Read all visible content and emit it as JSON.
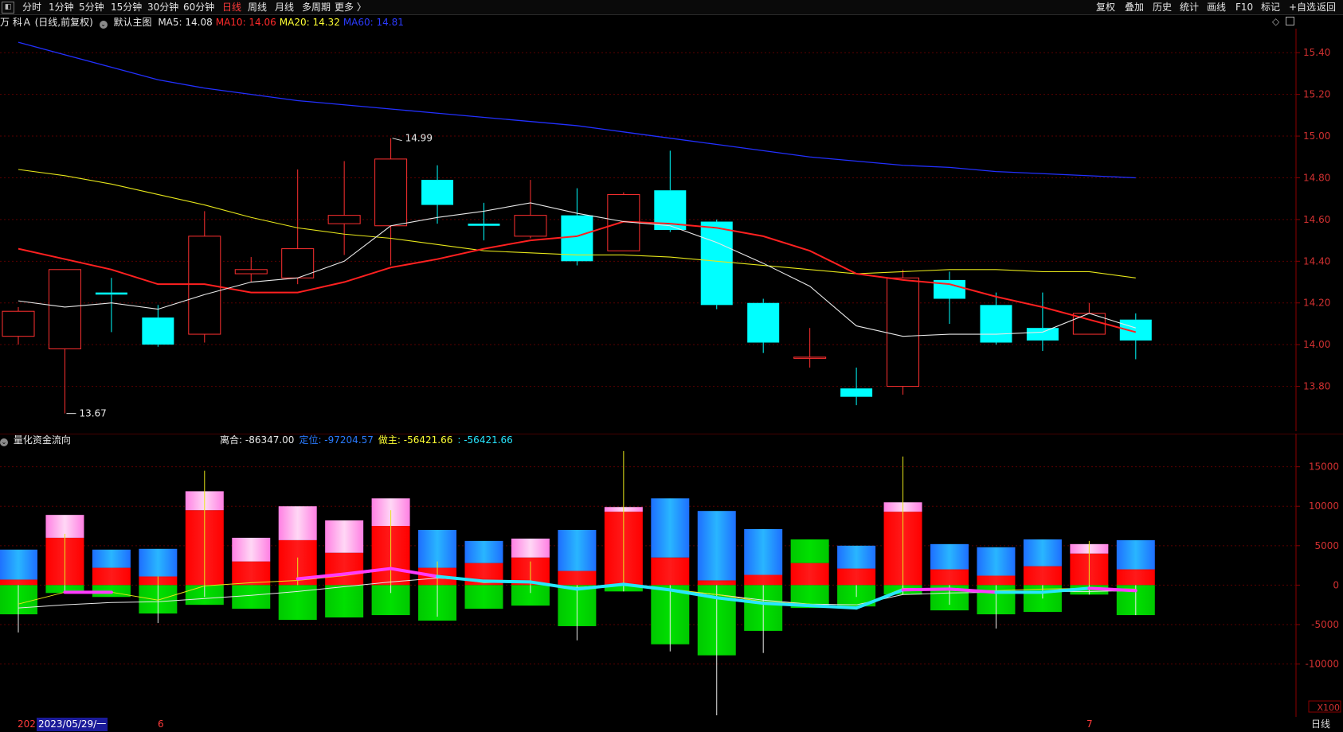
{
  "toolbar": {
    "left_items": [
      "分时",
      "1分钟",
      "5分钟",
      "15分钟",
      "30分钟",
      "60分钟",
      "日线",
      "周线",
      "月线",
      "多周期",
      "更多 〉"
    ],
    "active": "日线",
    "right_items": [
      "复权",
      "叠加",
      "历史",
      "统计",
      "画线",
      "F10",
      "标记",
      "+自选",
      "返回"
    ]
  },
  "main_chart": {
    "title": "万 科Ａ (日线,前复权)",
    "template_label": "默认主图",
    "ma": [
      {
        "label": "MA5: 14.08",
        "color": "#e8e8e8"
      },
      {
        "label": "MA10: 14.06",
        "color": "#ff2a2a"
      },
      {
        "label": "MA20: 14.32",
        "color": "#ffff33"
      },
      {
        "label": "MA60: 14.81",
        "color": "#2b3bff"
      }
    ],
    "high_label": "14.99",
    "low_label": "13.67",
    "y_ticks": [
      "15.40",
      "15.20",
      "15.00",
      "14.80",
      "14.60",
      "14.40",
      "14.20",
      "14.00",
      "13.80"
    ]
  },
  "sub_chart": {
    "title": "量化资金流向",
    "stats": [
      {
        "label": "离合: -86347.00",
        "color": "#e8e8e8"
      },
      {
        "label": "定位: -97204.57",
        "color": "#2a7bff"
      },
      {
        "label": "做主: -56421.66",
        "color": "#ffff33"
      },
      {
        "label": ": -56421.66",
        "color": "#28e6ff"
      }
    ],
    "y_ticks": [
      "15000",
      "10000",
      "5000",
      "0",
      "-5000",
      "-10000"
    ],
    "unit": "X100"
  },
  "bottom_bar": {
    "date_prefix": "202",
    "cursor_date": "2023/05/29/一",
    "month_marks": [
      "6",
      "7"
    ],
    "period_label": "日线"
  },
  "chart_data": {
    "type": "candlestick",
    "ylim": [
      13.6,
      15.5
    ],
    "candles": [
      {
        "o": 14.04,
        "h": 14.18,
        "l": 14.0,
        "c": 14.16
      },
      {
        "o": 13.98,
        "h": 14.36,
        "l": 13.67,
        "c": 14.36
      },
      {
        "o": 14.25,
        "h": 14.32,
        "l": 14.06,
        "c": 14.24
      },
      {
        "o": 14.13,
        "h": 14.19,
        "l": 13.99,
        "c": 14.0
      },
      {
        "o": 14.05,
        "h": 14.64,
        "l": 14.01,
        "c": 14.52
      },
      {
        "o": 14.34,
        "h": 14.42,
        "l": 14.3,
        "c": 14.36
      },
      {
        "o": 14.32,
        "h": 14.84,
        "l": 14.29,
        "c": 14.46
      },
      {
        "o": 14.58,
        "h": 14.88,
        "l": 14.43,
        "c": 14.62
      },
      {
        "o": 14.57,
        "h": 14.99,
        "l": 14.38,
        "c": 14.89
      },
      {
        "o": 14.79,
        "h": 14.86,
        "l": 14.58,
        "c": 14.67
      },
      {
        "o": 14.58,
        "h": 14.68,
        "l": 14.5,
        "c": 14.57
      },
      {
        "o": 14.52,
        "h": 14.79,
        "l": 14.51,
        "c": 14.62
      },
      {
        "o": 14.62,
        "h": 14.75,
        "l": 14.38,
        "c": 14.4
      },
      {
        "o": 14.45,
        "h": 14.73,
        "l": 14.45,
        "c": 14.72
      },
      {
        "o": 14.74,
        "h": 14.93,
        "l": 14.54,
        "c": 14.55
      },
      {
        "o": 14.59,
        "h": 14.6,
        "l": 14.17,
        "c": 14.19
      },
      {
        "o": 14.2,
        "h": 14.22,
        "l": 13.96,
        "c": 14.01
      },
      {
        "o": 13.94,
        "h": 14.08,
        "l": 13.89,
        "c": 13.94
      },
      {
        "o": 13.79,
        "h": 13.89,
        "l": 13.71,
        "c": 13.75
      },
      {
        "o": 13.8,
        "h": 14.36,
        "l": 13.76,
        "c": 14.32
      },
      {
        "o": 14.31,
        "h": 14.35,
        "l": 14.1,
        "c": 14.22
      },
      {
        "o": 14.19,
        "h": 14.25,
        "l": 14.0,
        "c": 14.01
      },
      {
        "o": 14.08,
        "h": 14.25,
        "l": 13.97,
        "c": 14.02
      },
      {
        "o": 14.05,
        "h": 14.2,
        "l": 14.05,
        "c": 14.15
      },
      {
        "o": 14.12,
        "h": 14.15,
        "l": 13.93,
        "c": 14.02
      }
    ],
    "ma5": [
      14.21,
      14.18,
      14.2,
      14.17,
      14.24,
      14.3,
      14.32,
      14.4,
      14.57,
      14.61,
      14.64,
      14.68,
      14.63,
      14.59,
      14.57,
      14.49,
      14.39,
      14.28,
      14.09,
      14.04,
      14.05,
      14.05,
      14.06,
      14.15,
      14.08
    ],
    "ma10": [
      14.46,
      14.41,
      14.36,
      14.29,
      14.29,
      14.25,
      14.25,
      14.3,
      14.37,
      14.41,
      14.46,
      14.5,
      14.52,
      14.59,
      14.58,
      14.56,
      14.52,
      14.45,
      14.34,
      14.31,
      14.29,
      14.23,
      14.18,
      14.12,
      14.06
    ],
    "ma20": [
      14.84,
      14.81,
      14.77,
      14.72,
      14.67,
      14.61,
      14.56,
      14.53,
      14.51,
      14.48,
      14.45,
      14.44,
      14.43,
      14.43,
      14.42,
      14.4,
      14.38,
      14.36,
      14.34,
      14.35,
      14.36,
      14.36,
      14.35,
      14.35,
      14.32
    ],
    "ma60": [
      15.45,
      15.39,
      15.33,
      15.27,
      15.23,
      15.2,
      15.17,
      15.15,
      15.13,
      15.11,
      15.09,
      15.07,
      15.05,
      15.02,
      14.99,
      14.96,
      14.93,
      14.9,
      14.88,
      14.86,
      14.85,
      14.83,
      14.82,
      14.81,
      14.8
    ],
    "flow_ylim": [
      -16500,
      19000
    ],
    "flow": [
      {
        "top": [
          {
            "v": 700,
            "c": "red"
          },
          {
            "v": 3800,
            "c": "blue"
          }
        ],
        "bot": -3700,
        "wick": [
          -6000,
          0
        ]
      },
      {
        "top": [
          {
            "v": 6000,
            "c": "red"
          },
          {
            "v": 2900,
            "c": "pink"
          }
        ],
        "bot": -1000,
        "wick": [
          -1000,
          6500
        ]
      },
      {
        "top": [
          {
            "v": 2200,
            "c": "red"
          },
          {
            "v": 2300,
            "c": "blue"
          }
        ],
        "bot": -1500,
        "wick": [
          0,
          0
        ]
      },
      {
        "top": [
          {
            "v": 1100,
            "c": "red"
          },
          {
            "v": 3500,
            "c": "blue"
          }
        ],
        "bot": -3600,
        "wick": [
          -4800,
          1100
        ]
      },
      {
        "top": [
          {
            "v": 9500,
            "c": "red"
          },
          {
            "v": 2400,
            "c": "pink"
          }
        ],
        "bot": -2500,
        "wick": [
          -1500,
          14500
        ]
      },
      {
        "top": [
          {
            "v": 3000,
            "c": "red"
          },
          {
            "v": 3000,
            "c": "pink"
          }
        ],
        "bot": -3000,
        "wick": [
          0,
          0
        ]
      },
      {
        "top": [
          {
            "v": 5700,
            "c": "red"
          },
          {
            "v": 4300,
            "c": "pink"
          }
        ],
        "bot": -4400,
        "wick": [
          0,
          3500
        ]
      },
      {
        "top": [
          {
            "v": 4100,
            "c": "red"
          },
          {
            "v": 4100,
            "c": "pink"
          }
        ],
        "bot": -4100,
        "wick": [
          0,
          0
        ]
      },
      {
        "top": [
          {
            "v": 7500,
            "c": "red"
          },
          {
            "v": 3500,
            "c": "pink"
          }
        ],
        "bot": -3800,
        "wick": [
          -1000,
          9500
        ]
      },
      {
        "top": [
          {
            "v": 2200,
            "c": "red"
          },
          {
            "v": 4800,
            "c": "blue"
          }
        ],
        "bot": -4500,
        "wick": [
          -4000,
          3000
        ]
      },
      {
        "top": [
          {
            "v": 2800,
            "c": "red"
          },
          {
            "v": 2800,
            "c": "blue"
          }
        ],
        "bot": -3000,
        "wick": [
          0,
          0
        ]
      },
      {
        "top": [
          {
            "v": 3500,
            "c": "red"
          },
          {
            "v": 2400,
            "c": "pink"
          }
        ],
        "bot": -2600,
        "wick": [
          -1000,
          3000
        ]
      },
      {
        "top": [
          {
            "v": 1800,
            "c": "red"
          },
          {
            "v": 5200,
            "c": "blue"
          }
        ],
        "bot": -5200,
        "wick": [
          -7000,
          0
        ]
      },
      {
        "top": [
          {
            "v": 9300,
            "c": "red"
          },
          {
            "v": 600,
            "c": "pink"
          }
        ],
        "bot": -800,
        "wick": [
          -800,
          17000
        ]
      },
      {
        "top": [
          {
            "v": 3500,
            "c": "red"
          },
          {
            "v": 7500,
            "c": "blue"
          }
        ],
        "bot": -7500,
        "wick": [
          -8400,
          0
        ]
      },
      {
        "top": [
          {
            "v": 600,
            "c": "red"
          },
          {
            "v": 8800,
            "c": "blue"
          }
        ],
        "bot": -8900,
        "wick": [
          -16500,
          0
        ]
      },
      {
        "top": [
          {
            "v": 1300,
            "c": "red"
          },
          {
            "v": 5800,
            "c": "blue"
          }
        ],
        "bot": -5800,
        "wick": [
          -8600,
          0
        ]
      },
      {
        "top": [
          {
            "v": 2800,
            "c": "red"
          },
          {
            "v": 3000,
            "c": "green"
          }
        ],
        "bot": -2900,
        "wick": [
          0,
          0
        ]
      },
      {
        "top": [
          {
            "v": 2100,
            "c": "red"
          },
          {
            "v": 2900,
            "c": "blue"
          }
        ],
        "bot": -2700,
        "wick": [
          -1500,
          0
        ]
      },
      {
        "top": [
          {
            "v": 9300,
            "c": "red"
          },
          {
            "v": 1200,
            "c": "pink"
          }
        ],
        "bot": -1200,
        "wick": [
          -1200,
          16300
        ]
      },
      {
        "top": [
          {
            "v": 2000,
            "c": "red"
          },
          {
            "v": 3200,
            "c": "blue"
          }
        ],
        "bot": -3200,
        "wick": [
          -2500,
          0
        ]
      },
      {
        "top": [
          {
            "v": 1200,
            "c": "red"
          },
          {
            "v": 3600,
            "c": "blue"
          }
        ],
        "bot": -3700,
        "wick": [
          -5500,
          0
        ]
      },
      {
        "top": [
          {
            "v": 2400,
            "c": "red"
          },
          {
            "v": 3400,
            "c": "blue"
          }
        ],
        "bot": -3400,
        "wick": [
          -1700,
          0
        ]
      },
      {
        "top": [
          {
            "v": 4000,
            "c": "red"
          },
          {
            "v": 1200,
            "c": "pink"
          }
        ],
        "bot": -1200,
        "wick": [
          -1200,
          5600
        ]
      },
      {
        "top": [
          {
            "v": 2000,
            "c": "red"
          },
          {
            "v": 3700,
            "c": "blue"
          }
        ],
        "bot": -3800,
        "wick": [
          -3800,
          0
        ]
      }
    ],
    "line_white": [
      -2900,
      -2500,
      -2200,
      -2100,
      -1700,
      -1300,
      -800,
      -200,
      400,
      900,
      600,
      300,
      -300,
      100,
      -600,
      -1200,
      -1900,
      -2400,
      -2500,
      -1200,
      -1000,
      -900,
      -800,
      -800,
      -700
    ],
    "line_yellow": [
      -2400,
      -900,
      -900,
      -1900,
      -100,
      300,
      600,
      1200,
      2000,
      1200,
      300,
      500,
      -400,
      100,
      -500,
      -1200,
      -2100,
      -2400,
      -2800,
      -400,
      -600,
      -700,
      -500,
      -400,
      -500
    ],
    "line_thick": [
      null,
      -900,
      -900,
      null,
      null,
      null,
      800,
      1400,
      2100,
      1100,
      500,
      400,
      -500,
      100,
      -600,
      -1600,
      -2300,
      -2600,
      -2900,
      -600,
      -500,
      -900,
      -900,
      -400,
      -700
    ],
    "thick_colors": [
      "#ff3bff",
      "#ff3bff",
      "#ff3bff",
      "#ff3bff",
      "#ff3bff",
      "#ff3bff",
      "#ff3bff",
      "#ff3bff",
      "#ff3bff",
      "#28e6ff",
      "#28e6ff",
      "#28e6ff",
      "#28e6ff",
      "#28e6ff",
      "#28e6ff",
      "#28e6ff",
      "#28e6ff",
      "#28e6ff",
      "#28e6ff",
      "#ff3bff",
      "#ff3bff",
      "#28e6ff",
      "#28e6ff",
      "#ff3bff",
      "#28e6ff"
    ]
  }
}
